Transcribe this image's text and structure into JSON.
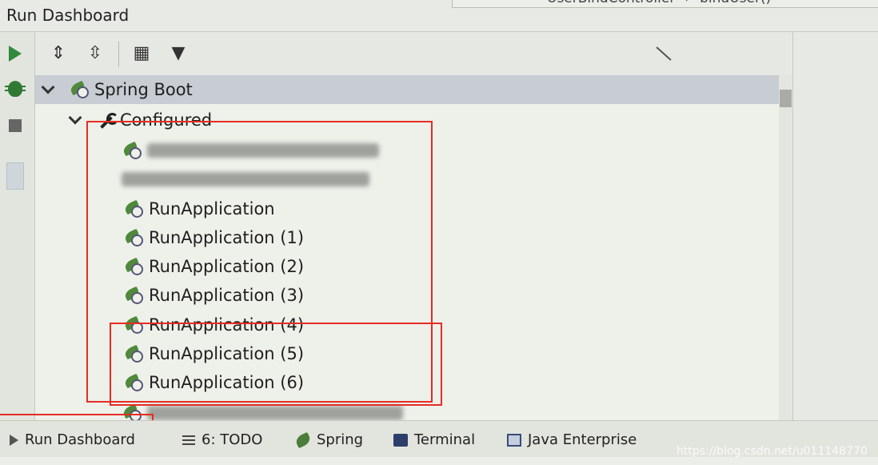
{
  "header": {
    "title": "Run Dashboard",
    "breadcrumb": [
      "UserBindController",
      "bindUser()"
    ]
  },
  "tree": {
    "root": {
      "label": "Spring Boot",
      "icon": "spring-boot-icon"
    },
    "group": {
      "label": "Configured",
      "icon": "wrench-icon"
    },
    "items": [
      {
        "label": "RunApplication"
      },
      {
        "label": "RunApplication (1)"
      },
      {
        "label": "RunApplication (2)"
      },
      {
        "label": "RunApplication (3)"
      },
      {
        "label": "RunApplication (4)"
      },
      {
        "label": "RunApplication (5)"
      },
      {
        "label": "RunApplication (6)"
      }
    ]
  },
  "bottombar": {
    "items": [
      {
        "label": "Run Dashboard",
        "icon": "run-icon"
      },
      {
        "label": "6: TODO",
        "icon": "todo-icon"
      },
      {
        "label": "Spring",
        "icon": "spring-icon"
      },
      {
        "label": "Terminal",
        "icon": "terminal-icon"
      },
      {
        "label": "Java Enterprise",
        "icon": "java-enterprise-icon"
      }
    ],
    "watermark": "https://blog.csdn.net/u011148770"
  },
  "colors": {
    "highlight_box": "#e52d23",
    "selected_row": "#c8ccd3",
    "run_green": "#2f8a3c"
  }
}
